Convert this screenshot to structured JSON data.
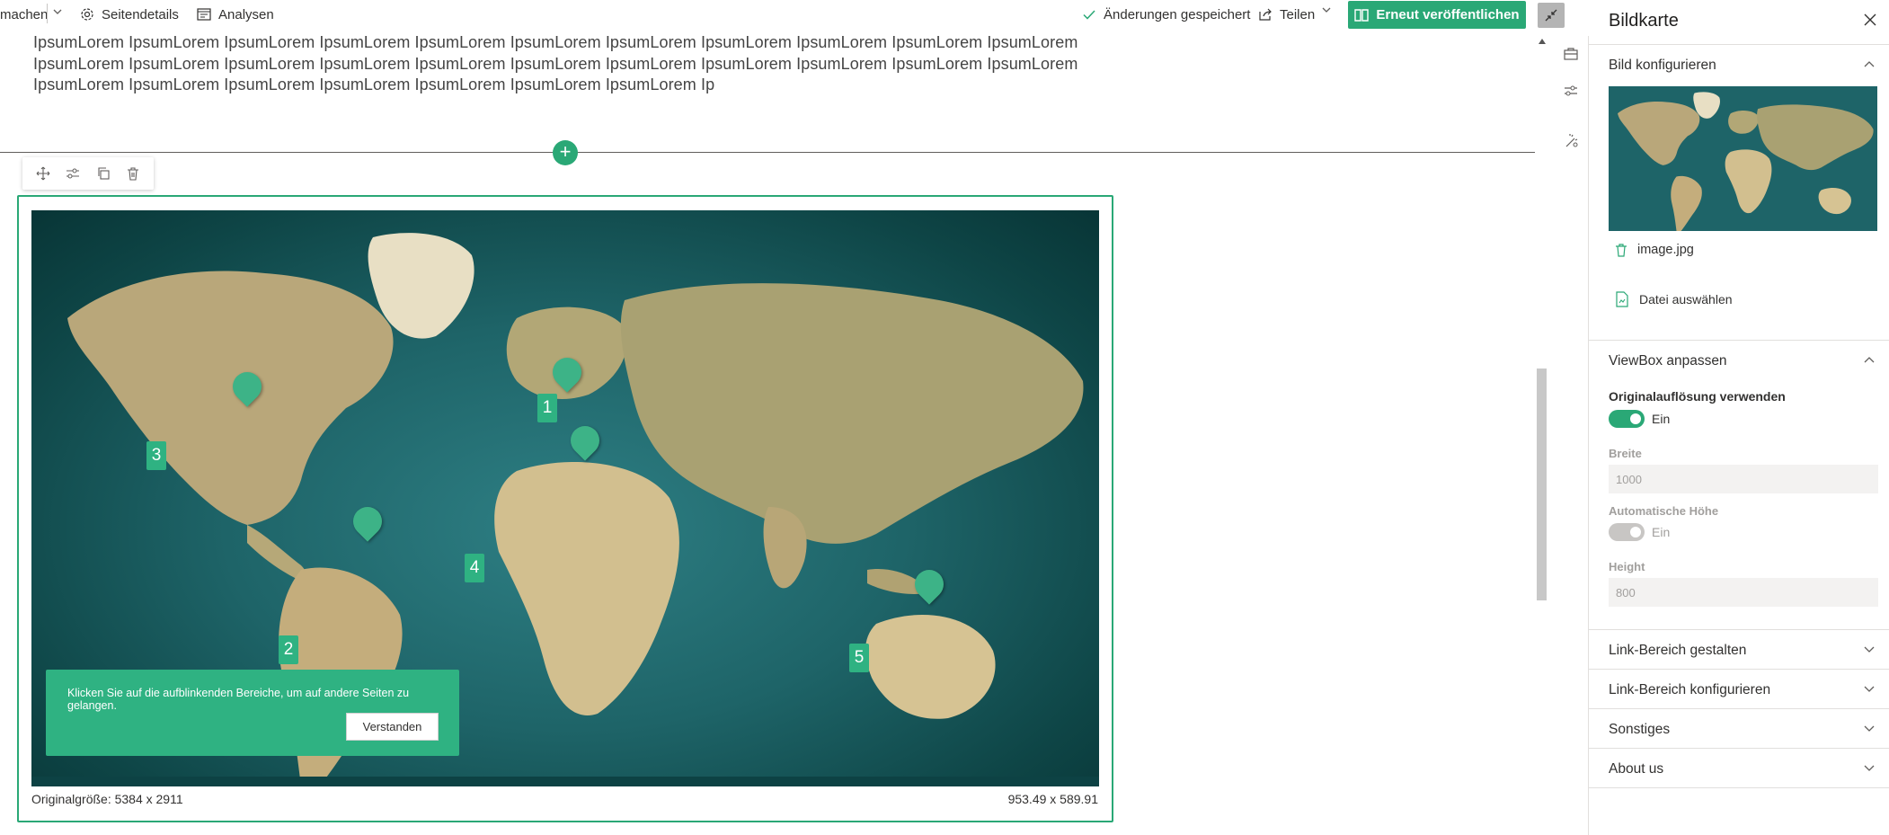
{
  "commandbar": {
    "edit_label": "machen",
    "page_details_label": "Seitendetails",
    "analytics_label": "Analysen",
    "saved_status": "Änderungen gespeichert",
    "share_label": "Teilen",
    "republish_label": "Erneut veröffentlichen"
  },
  "content": {
    "lorem_line_1": "IpsumLorem IpsumLorem IpsumLorem IpsumLorem IpsumLorem IpsumLorem IpsumLorem IpsumLorem IpsumLorem IpsumLorem IpsumLorem",
    "lorem_line_2": "IpsumLorem IpsumLorem IpsumLorem IpsumLorem IpsumLorem IpsumLorem IpsumLorem IpsumLorem IpsumLorem IpsumLorem IpsumLorem",
    "lorem_line_3": "IpsumLorem IpsumLorem IpsumLorem IpsumLorem IpsumLorem IpsumLorem IpsumLorem Ip",
    "add_section": "+"
  },
  "imagemap": {
    "badges": [
      "1",
      "2",
      "3",
      "4",
      "5"
    ],
    "info_text": "Klicken Sie auf die aufblinkenden Bereiche, um auf andere Seiten zu gelangen.",
    "ok_label": "Verstanden",
    "original_size": "Originalgröße: 5384 x 2911",
    "display_size": "953.49 x 589.91"
  },
  "pane": {
    "title": "Bildkarte",
    "group_configure_image": "Bild konfigurieren",
    "file_name": "image.jpg",
    "choose_file": "Datei auswählen",
    "group_viewbox": "ViewBox anpassen",
    "use_original_label": "Originalauflösung verwenden",
    "use_original_state": "Ein",
    "width_label": "Breite",
    "width_value": "1000",
    "auto_height_label": "Automatische Höhe",
    "auto_height_state": "Ein",
    "height_label": "Height",
    "height_value": "800",
    "group_link_design": "Link-Bereich gestalten",
    "group_link_config": "Link-Bereich konfigurieren",
    "group_misc": "Sonstiges",
    "group_about": "About us"
  },
  "colors": {
    "accent": "#2aa876",
    "badge": "#2fb282",
    "ocean": "#1e6468"
  }
}
